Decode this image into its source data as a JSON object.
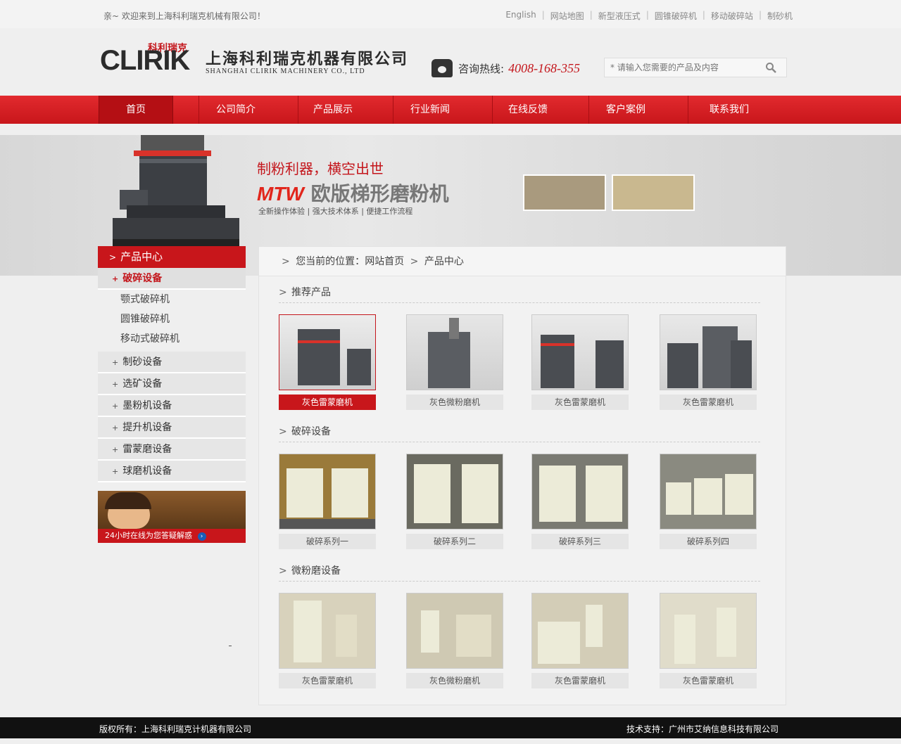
{
  "topbar": {
    "welcome": "亲~  欢迎来到上海科利瑞克机械有限公司！",
    "links": [
      "English",
      "网站地图",
      "新型液压式",
      "圆锥破碎机",
      "移动破碎站",
      "制砂机"
    ]
  },
  "header": {
    "logo_clirik": "CLIRIK",
    "logo_cn_small": "科利瑞克",
    "company_cn": "上海科利瑞克机器有限公司",
    "company_en": "SHANGHAI CLIRIK MACHINERY CO., LTD",
    "hotline_label": "咨询热线:",
    "hotline_number": "4008-168-355",
    "search_placeholder": "* 请输入您需要的产品及内容"
  },
  "nav": {
    "items": [
      "首页",
      "公司简介",
      "产品展示",
      "行业新闻",
      "在线反馈",
      "客户案例",
      "联系我们"
    ],
    "active": "首页"
  },
  "banner": {
    "slogan": "制粉利器，横空出世",
    "product_prefix": "MTW",
    "product_name": "欧版梯形磨粉机",
    "features": "全新操作体验  |  强大技术体系  |  便捷工作流程"
  },
  "sidebar": {
    "title": "产品中心",
    "categories": [
      {
        "label": "破碎设备",
        "active": true,
        "children": [
          "颚式破碎机",
          "圆锥破碎机",
          "移动式破碎机"
        ]
      },
      {
        "label": "制砂设备"
      },
      {
        "label": "选矿设备"
      },
      {
        "label": "墨粉机设备"
      },
      {
        "label": "提升机设备"
      },
      {
        "label": "雷蒙磨设备"
      },
      {
        "label": "球磨机设备"
      }
    ],
    "service_text": "24小时在线为您答疑解惑"
  },
  "main": {
    "breadcrumb": {
      "prefix": "您当前的位置：",
      "home": "网站首页",
      "current": "产品中心"
    },
    "sections": [
      {
        "title": "推荐产品",
        "products": [
          "灰色雷蒙磨机",
          "灰色微粉磨机",
          "灰色雷蒙磨机",
          "灰色雷蒙磨机"
        ],
        "active_index": 0
      },
      {
        "title": "破碎设备",
        "products": [
          "破碎系列一",
          "破碎系列二",
          "破碎系列三",
          "破碎系列四"
        ]
      },
      {
        "title": "微粉磨设备",
        "products": [
          "灰色雷蒙磨机",
          "灰色微粉磨机",
          "灰色雷蒙磨机",
          "灰色雷蒙磨机"
        ]
      }
    ]
  },
  "footer": {
    "copyright": "版权所有：上海科利瑞克计机器有限公司",
    "support": "技术支持：广州市艾纳信息科技有限公司"
  },
  "colors": {
    "brand_red": "#c8161b",
    "footer_bg": "#111111"
  }
}
